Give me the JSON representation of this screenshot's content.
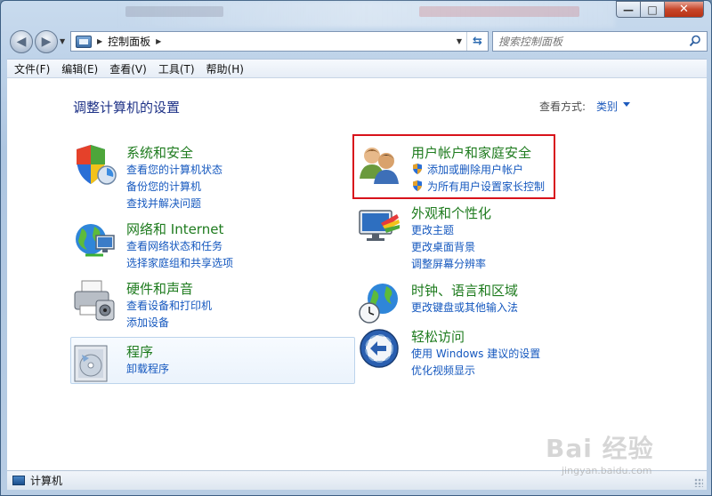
{
  "window": {
    "buttons": {
      "minimize": "—",
      "maximize": "□",
      "close": "✕"
    }
  },
  "navigation": {
    "back_icon": "back-arrow-icon",
    "forward_icon": "forward-arrow-icon",
    "address": {
      "path": "控制面板",
      "icon": "control-panel-icon"
    },
    "search": {
      "placeholder": "搜索控制面板"
    }
  },
  "menubar": {
    "items": [
      "文件(F)",
      "编辑(E)",
      "查看(V)",
      "工具(T)",
      "帮助(H)"
    ]
  },
  "content": {
    "title": "调整计算机的设置",
    "view_by": {
      "label": "查看方式:",
      "value": "类别"
    },
    "categories": {
      "system": {
        "title": "系统和安全",
        "icon": "shield-icon",
        "links": [
          "查看您的计算机状态",
          "备份您的计算机",
          "查找并解决问题"
        ]
      },
      "network": {
        "title": "网络和 Internet",
        "icon": "globe-network-icon",
        "links": [
          "查看网络状态和任务",
          "选择家庭组和共享选项"
        ]
      },
      "hardware": {
        "title": "硬件和声音",
        "icon": "printer-icon",
        "links": [
          "查看设备和打印机",
          "添加设备"
        ]
      },
      "programs": {
        "title": "程序",
        "icon": "programs-disc-icon",
        "links": [
          "卸载程序"
        ]
      },
      "users": {
        "title": "用户帐户和家庭安全",
        "icon": "users-icon",
        "links": [
          "添加或删除用户帐户",
          "为所有用户设置家长控制"
        ]
      },
      "appearance": {
        "title": "外观和个性化",
        "icon": "monitor-palette-icon",
        "links": [
          "更改主题",
          "更改桌面背景",
          "调整屏幕分辨率"
        ]
      },
      "clock": {
        "title": "时钟、语言和区域",
        "icon": "globe-clock-icon",
        "links": [
          "更改键盘或其他输入法"
        ]
      },
      "ease": {
        "title": "轻松访问",
        "icon": "ease-of-access-icon",
        "links": [
          "使用 Windows 建议的设置",
          "优化视频显示"
        ]
      }
    }
  },
  "statusbar": {
    "text": "计算机"
  },
  "watermark": {
    "brand": "Bai 经验",
    "url": "jingyan.baidu.com"
  }
}
